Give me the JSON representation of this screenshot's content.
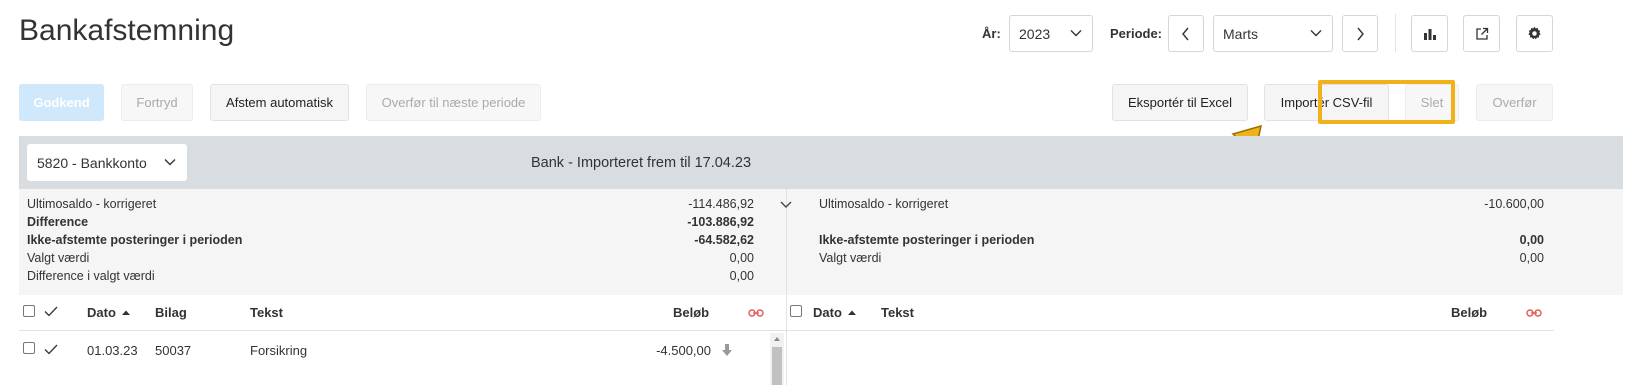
{
  "page": {
    "title": "Bankafstemning"
  },
  "header": {
    "year_label": "År:",
    "year_value": "2023",
    "period_label": "Periode:",
    "period_value": "Marts"
  },
  "toolbar": {
    "approve": "Godkend",
    "undo": "Fortryd",
    "auto_match": "Afstem automatisk",
    "transfer_next": "Overfør til næste periode",
    "export_excel": "Eksportér til Excel",
    "import_csv": "Importér CSV-fil",
    "delete": "Slet",
    "transfer": "Overfør"
  },
  "account": {
    "selected": "5820 - Bankkonto",
    "import_status": "Bank - Importeret frem til 17.04.23"
  },
  "summary_left": [
    {
      "label": "Ultimosaldo - korrigeret",
      "value": "-114.486,92",
      "bold": false
    },
    {
      "label": "Difference",
      "value": "-103.886,92",
      "bold": true
    },
    {
      "label": "Ikke-afstemte posteringer i perioden",
      "value": "-64.582,62",
      "bold": true
    },
    {
      "label": "Valgt værdi",
      "value": "0,00",
      "bold": false
    },
    {
      "label": "Difference i valgt værdi",
      "value": "0,00",
      "bold": false
    }
  ],
  "summary_right": [
    {
      "label": "Ultimosaldo - korrigeret",
      "value": "-10.600,00",
      "bold": false
    },
    {
      "label": "Ikke-afstemte posteringer i perioden",
      "value": "0,00",
      "bold": true
    },
    {
      "label": "Valgt værdi",
      "value": "0,00",
      "bold": false
    }
  ],
  "left_table": {
    "columns": {
      "date": "Dato",
      "voucher": "Bilag",
      "text": "Tekst",
      "amount": "Beløb"
    },
    "rows": [
      {
        "date": "01.03.23",
        "voucher": "50037",
        "text": "Forsikring",
        "amount": "-4.500,00"
      }
    ]
  },
  "right_table": {
    "columns": {
      "date": "Dato",
      "text": "Tekst",
      "amount": "Beløb"
    }
  },
  "colors": {
    "highlight": "#f0b21a",
    "link_icon": "#e05a5a",
    "primary_disabled": "#cfe8fb"
  },
  "icons": [
    "chevron-down-icon",
    "chevron-left-icon",
    "chevron-right-icon",
    "bar-chart-icon",
    "external-link-icon",
    "gear-icon",
    "check-icon",
    "sort-asc-icon",
    "unlink-icon",
    "download-arrow-icon"
  ]
}
